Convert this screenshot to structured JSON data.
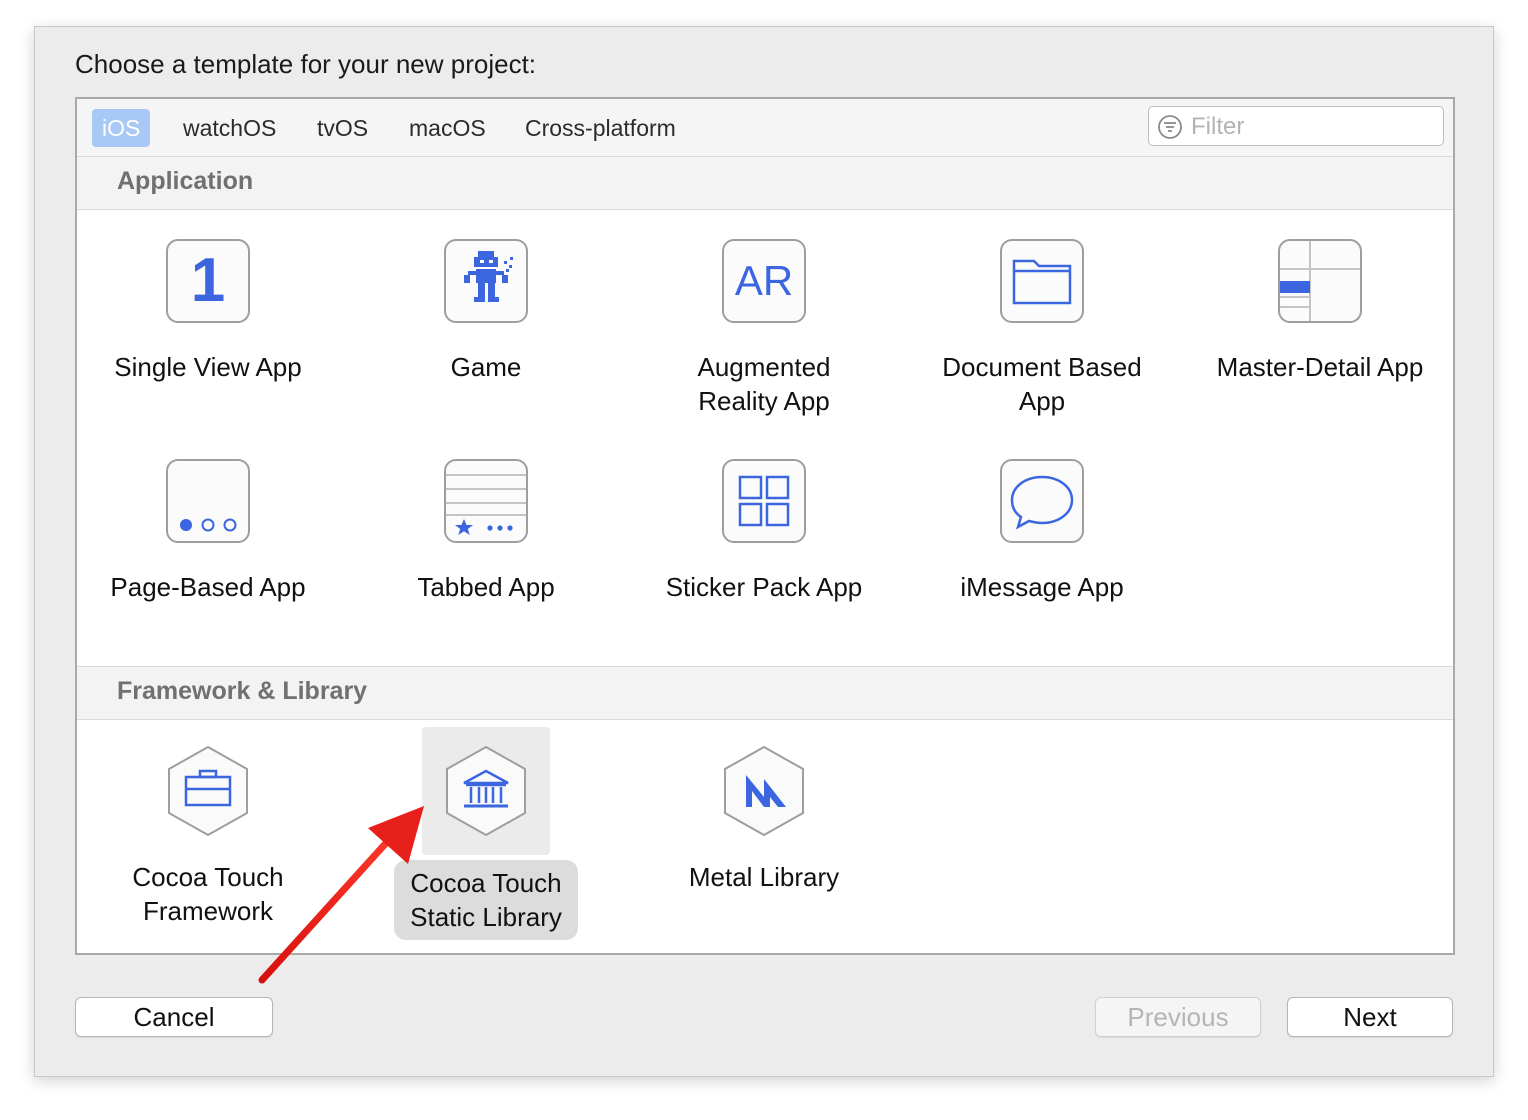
{
  "dialog": {
    "heading": "Choose a template for your new project:",
    "tabs": [
      {
        "label": "iOS",
        "selected": true
      },
      {
        "label": "watchOS"
      },
      {
        "label": "tvOS"
      },
      {
        "label": "macOS"
      },
      {
        "label": "Cross-platform"
      }
    ],
    "filter": {
      "placeholder": "Filter",
      "icon": "filter-icon"
    },
    "sections": [
      {
        "title": "Application",
        "items": [
          {
            "line1": "Single View App",
            "line2": "",
            "icon": "single-view-icon"
          },
          {
            "line1": "Game",
            "line2": "",
            "icon": "game-icon"
          },
          {
            "line1": "Augmented",
            "line2": "Reality App",
            "icon": "ar-icon"
          },
          {
            "line1": "Document Based",
            "line2": "App",
            "icon": "folder-icon"
          },
          {
            "line1": "Master-Detail App",
            "line2": "",
            "icon": "master-detail-icon"
          },
          {
            "line1": "Page-Based App",
            "line2": "",
            "icon": "page-dots-icon"
          },
          {
            "line1": "Tabbed App",
            "line2": "",
            "icon": "tab-bar-icon"
          },
          {
            "line1": "Sticker Pack App",
            "line2": "",
            "icon": "sticker-grid-icon"
          },
          {
            "line1": "iMessage App",
            "line2": "",
            "icon": "message-bubble-icon"
          }
        ]
      },
      {
        "title": "Framework & Library",
        "items": [
          {
            "line1": "Cocoa Touch",
            "line2": "Framework",
            "icon": "toolbox-icon"
          },
          {
            "line1": "Cocoa Touch",
            "line2": "Static Library",
            "icon": "library-building-icon",
            "selected": true
          },
          {
            "line1": "Metal Library",
            "line2": "",
            "icon": "metal-icon"
          }
        ]
      }
    ],
    "ar_glyph": "AR",
    "single_view_glyph": "1",
    "buttons": {
      "cancel": "Cancel",
      "previous": "Previous",
      "next": "Next"
    },
    "colors": {
      "accent": "#3b66e0",
      "selected_tab": "#a8c9f6",
      "arrow": "#e8201c"
    }
  }
}
